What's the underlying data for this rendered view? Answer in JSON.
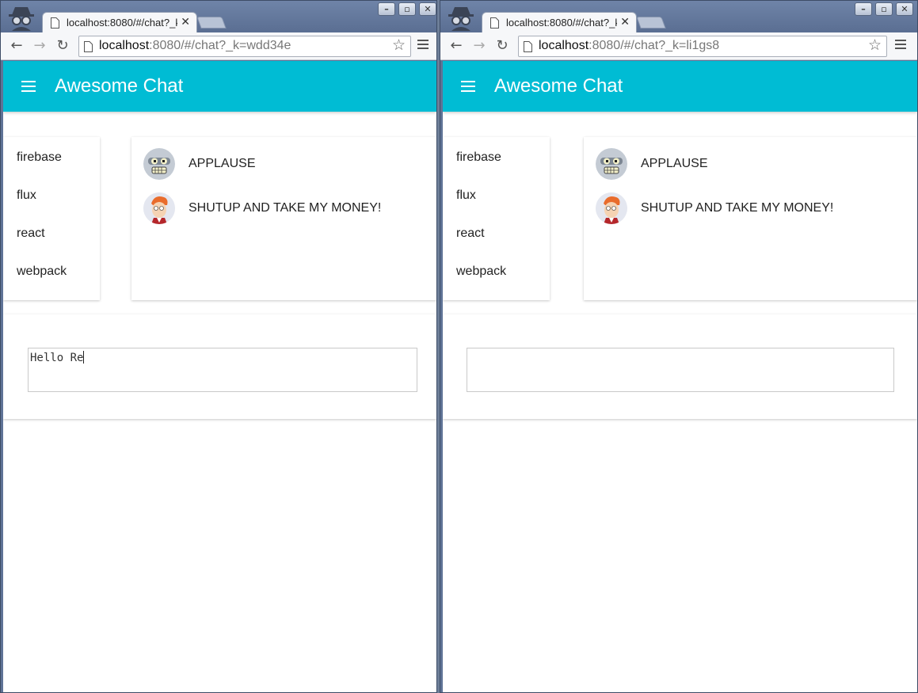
{
  "windows": [
    {
      "tab_title": "localhost:8080/#/chat?_k",
      "url_host": "localhost",
      "url_rest": ":8080/#/chat?_k=wdd34e",
      "app_title": "Awesome Chat",
      "channels": [
        "firebase",
        "flux",
        "react",
        "webpack"
      ],
      "messages": [
        {
          "avatar": "robot-avatar",
          "text": "APPLAUSE"
        },
        {
          "avatar": "fry-avatar",
          "text": "SHUTUP AND TAKE MY MONEY!"
        }
      ],
      "input_value": "Hello Re"
    },
    {
      "tab_title": "localhost:8080/#/chat?_k",
      "url_host": "localhost",
      "url_rest": ":8080/#/chat?_k=li1gs8",
      "app_title": "Awesome Chat",
      "channels": [
        "firebase",
        "flux",
        "react",
        "webpack"
      ],
      "messages": [
        {
          "avatar": "robot-avatar",
          "text": "APPLAUSE"
        },
        {
          "avatar": "fry-avatar",
          "text": "SHUTUP AND TAKE MY MONEY!"
        }
      ],
      "input_value": ""
    }
  ],
  "colors": {
    "appbar": "#00bcd4",
    "titlebar": "#5f7396"
  },
  "icons": [
    "incognito-icon",
    "page-icon",
    "close-icon",
    "back-icon",
    "forward-icon",
    "reload-icon",
    "star-icon",
    "menu-icon",
    "hamburger-icon"
  ]
}
